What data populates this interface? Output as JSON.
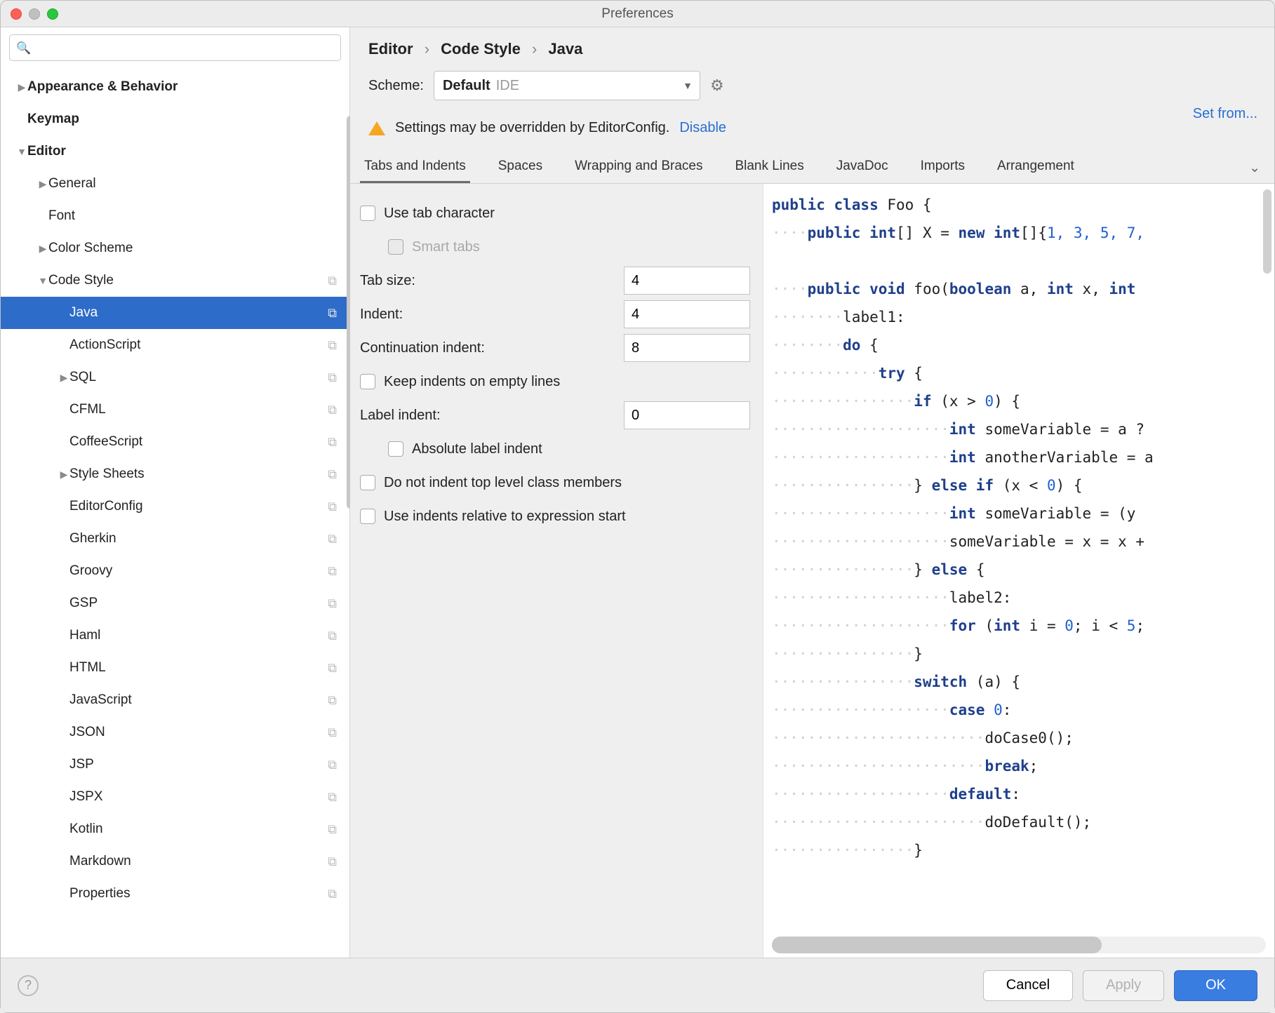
{
  "window": {
    "title": "Preferences"
  },
  "search": {
    "placeholder": ""
  },
  "tree": [
    {
      "label": "Appearance & Behavior",
      "indent": 0,
      "arrow": "▶",
      "bold": true
    },
    {
      "label": "Keymap",
      "indent": 0,
      "arrow": "",
      "bold": true
    },
    {
      "label": "Editor",
      "indent": 0,
      "arrow": "▼",
      "bold": true
    },
    {
      "label": "General",
      "indent": 1,
      "arrow": "▶"
    },
    {
      "label": "Font",
      "indent": 1,
      "arrow": ""
    },
    {
      "label": "Color Scheme",
      "indent": 1,
      "arrow": "▶"
    },
    {
      "label": "Code Style",
      "indent": 1,
      "arrow": "▼",
      "copy": true
    },
    {
      "label": "Java",
      "indent": 2,
      "arrow": "",
      "selected": true,
      "copy": true
    },
    {
      "label": "ActionScript",
      "indent": 2,
      "arrow": "",
      "copy": true
    },
    {
      "label": "SQL",
      "indent": 2,
      "arrow": "▶",
      "copy": true
    },
    {
      "label": "CFML",
      "indent": 2,
      "arrow": "",
      "copy": true
    },
    {
      "label": "CoffeeScript",
      "indent": 2,
      "arrow": "",
      "copy": true
    },
    {
      "label": "Style Sheets",
      "indent": 2,
      "arrow": "▶",
      "copy": true
    },
    {
      "label": "EditorConfig",
      "indent": 2,
      "arrow": "",
      "copy": true
    },
    {
      "label": "Gherkin",
      "indent": 2,
      "arrow": "",
      "copy": true
    },
    {
      "label": "Groovy",
      "indent": 2,
      "arrow": "",
      "copy": true
    },
    {
      "label": "GSP",
      "indent": 2,
      "arrow": "",
      "copy": true
    },
    {
      "label": "Haml",
      "indent": 2,
      "arrow": "",
      "copy": true
    },
    {
      "label": "HTML",
      "indent": 2,
      "arrow": "",
      "copy": true
    },
    {
      "label": "JavaScript",
      "indent": 2,
      "arrow": "",
      "copy": true
    },
    {
      "label": "JSON",
      "indent": 2,
      "arrow": "",
      "copy": true
    },
    {
      "label": "JSP",
      "indent": 2,
      "arrow": "",
      "copy": true
    },
    {
      "label": "JSPX",
      "indent": 2,
      "arrow": "",
      "copy": true
    },
    {
      "label": "Kotlin",
      "indent": 2,
      "arrow": "",
      "copy": true
    },
    {
      "label": "Markdown",
      "indent": 2,
      "arrow": "",
      "copy": true
    },
    {
      "label": "Properties",
      "indent": 2,
      "arrow": "",
      "copy": true
    }
  ],
  "breadcrumb": {
    "a": "Editor",
    "b": "Code Style",
    "c": "Java"
  },
  "scheme": {
    "label": "Scheme:",
    "name": "Default",
    "suffix": "IDE"
  },
  "setfrom": "Set from...",
  "warning": {
    "text": "Settings may be overridden by EditorConfig.",
    "link": "Disable"
  },
  "tabs": [
    "Tabs and Indents",
    "Spaces",
    "Wrapping and Braces",
    "Blank Lines",
    "JavaDoc",
    "Imports",
    "Arrangement"
  ],
  "settings": {
    "use_tab_char": "Use tab character",
    "smart_tabs": "Smart tabs",
    "tab_size_label": "Tab size:",
    "tab_size_value": "4",
    "indent_label": "Indent:",
    "indent_value": "4",
    "cont_label": "Continuation indent:",
    "cont_value": "8",
    "keep_empty": "Keep indents on empty lines",
    "label_indent_label": "Label indent:",
    "label_indent_value": "0",
    "abs_label": "Absolute label indent",
    "no_top_level": "Do not indent top level class members",
    "rel_expr": "Use indents relative to expression start"
  },
  "preview": {
    "l1a": "public class",
    "l1b": " Foo {",
    "l2a": "public int",
    "l2b": "[] X = ",
    "l2c": "new int",
    "l2d": "[]{",
    "l2nums": "1, 3, 5, 7,",
    "l3a": "public void",
    "l3b": " foo(",
    "l3c": "boolean",
    "l3d": " a, ",
    "l3e": "int",
    "l3f": " x, ",
    "l3g": "int",
    "l4": "label1:",
    "l5a": "do",
    "l5b": " {",
    "l6a": "try",
    "l6b": " {",
    "l7a": "if",
    "l7b": " (x > ",
    "l7c": "0",
    "l7d": ") {",
    "l8a": "int",
    "l8b": " someVariable = a ?",
    "l9a": "int",
    "l9b": " anotherVariable = a",
    "l10a": "} ",
    "l10b": "else if",
    "l10c": " (x < ",
    "l10d": "0",
    "l10e": ") {",
    "l11a": "int",
    "l11b": " someVariable = (y ",
    "l12": "someVariable = x = x +",
    "l13a": "} ",
    "l13b": "else",
    "l13c": " {",
    "l14": "label2:",
    "l15a": "for",
    "l15b": " (",
    "l15c": "int",
    "l15d": " i = ",
    "l15e": "0",
    "l15f": "; i < ",
    "l15g": "5",
    "l15h": ";",
    "l16": "}",
    "l17a": "switch",
    "l17b": " (a) {",
    "l18a": "case ",
    "l18b": "0",
    "l18c": ":",
    "l19": "doCase0();",
    "l20a": "break",
    "l20b": ";",
    "l21a": "default",
    "l21b": ":",
    "l22": "doDefault();",
    "l23": "}"
  },
  "footer": {
    "cancel": "Cancel",
    "apply": "Apply",
    "ok": "OK"
  }
}
